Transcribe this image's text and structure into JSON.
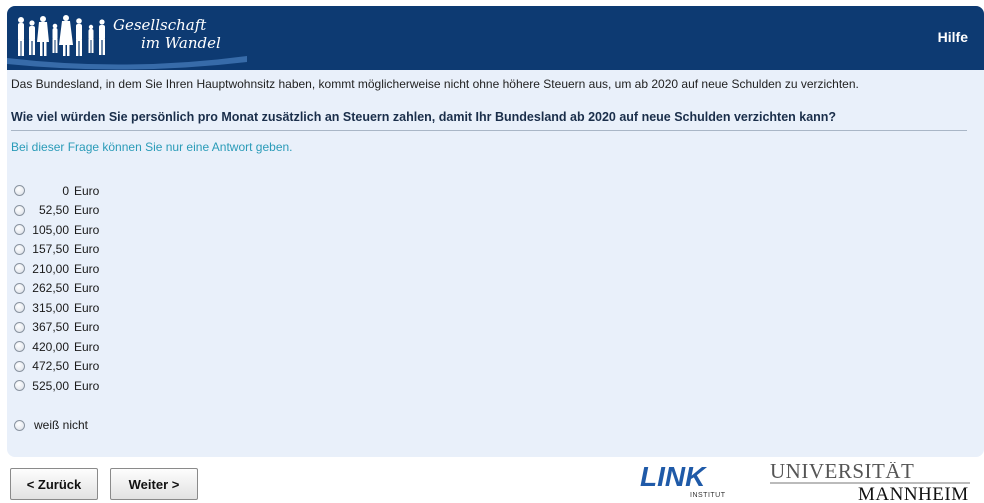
{
  "header": {
    "logo_line1": "Gesellschaft",
    "logo_line2": "im Wandel",
    "help_label": "Hilfe",
    "colors": {
      "header_bg": "#0d3a72",
      "panel_bg": "#e9f0fa",
      "hint": "#2a9bb8"
    }
  },
  "survey": {
    "intro": "Das Bundesland, in dem Sie Ihren Hauptwohnsitz haben, kommt möglicherweise nicht ohne höhere Steuern aus, um ab 2020 auf neue Schulden zu verzichten.",
    "question": "Wie viel würden Sie persönlich pro Monat zusätzlich an Steuern zahlen, damit Ihr Bundesland ab 2020 auf neue Schulden verzichten kann?",
    "hint": "Bei dieser Frage können Sie nur eine Antwort geben.",
    "currency": "Euro",
    "options": [
      "0",
      "52,50",
      "105,00",
      "157,50",
      "210,00",
      "262,50",
      "315,00",
      "367,50",
      "420,00",
      "472,50",
      "525,00"
    ],
    "dont_know": "weiß nicht"
  },
  "nav": {
    "back_label": "< Zurück",
    "next_label": "Weiter >"
  },
  "footer": {
    "link_logo": "LINK",
    "link_sub": "INSTITUT",
    "uni_line1": "UNIVERSITÄT",
    "uni_line2": "MANNHEIM"
  }
}
